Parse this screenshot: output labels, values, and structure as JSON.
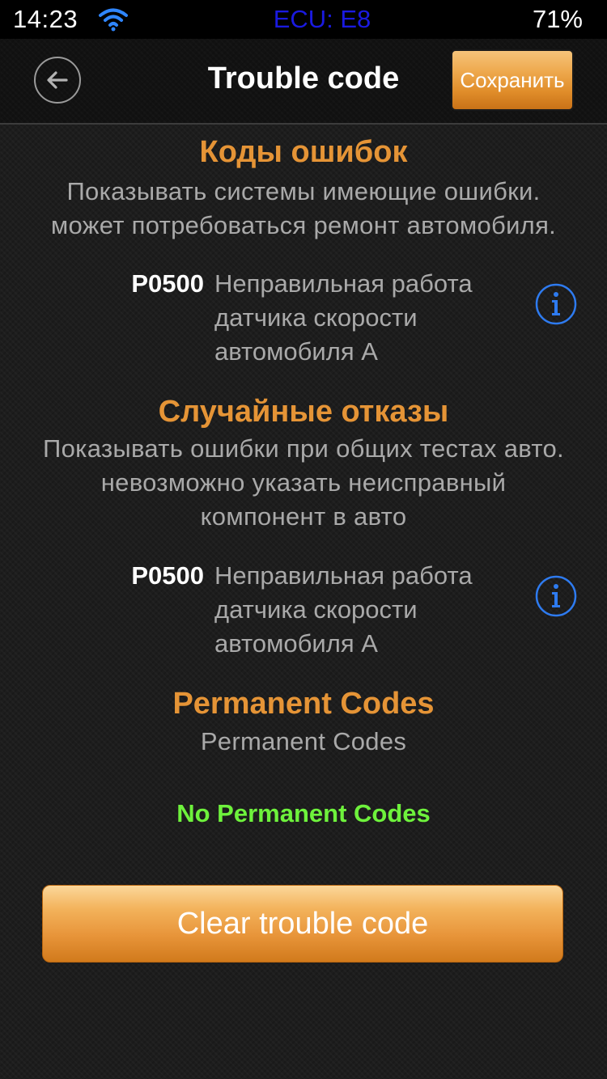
{
  "status_bar": {
    "time": "14:23",
    "wifi_icon": "wifi-icon",
    "ecu": "ECU: E8",
    "ecu_color": "#1a1ae0",
    "battery": "71%"
  },
  "nav": {
    "back_icon": "arrow-left-circle-icon",
    "title": "Trouble code",
    "save_label": "Сохранить"
  },
  "sections": [
    {
      "title": "Коды ошибок",
      "description_lines": [
        "Показывать системы имеющие ошибки.",
        "может потребоваться ремонт автомобиля."
      ],
      "codes": [
        {
          "code": "P0500",
          "description_lines": [
            "Неправильная работа",
            "датчика скорости",
            "автомобиля A"
          ],
          "info_icon": "info-icon"
        }
      ]
    },
    {
      "title": "Случайные отказы",
      "description_lines": [
        "Показывать ошибки при общих тестах авто.",
        "невозможно указать неисправный",
        "компонент в авто"
      ],
      "codes": [
        {
          "code": "P0500",
          "description_lines": [
            "Неправильная работа",
            "датчика скорости",
            "автомобиля A"
          ],
          "info_icon": "info-icon"
        }
      ]
    },
    {
      "title": "Permanent Codes",
      "description_lines": [
        "Permanent Codes"
      ],
      "empty_message": "No Permanent Codes"
    }
  ],
  "clear_button_label": "Clear trouble code",
  "colors": {
    "accent_orange": "#e59436",
    "success_green": "#6ef23c",
    "info_blue": "#2e7bf0",
    "muted_text": "#a9a9a9"
  }
}
